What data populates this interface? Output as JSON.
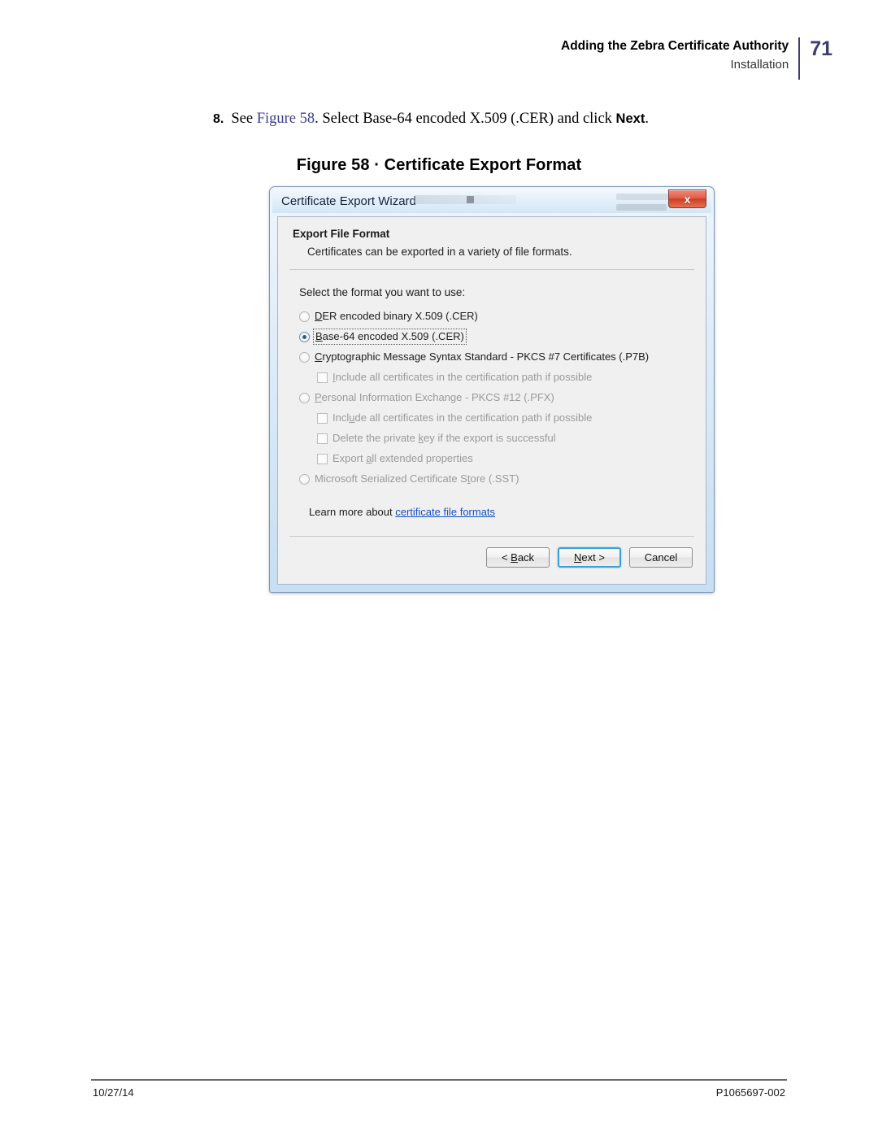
{
  "header": {
    "title": "Adding the Zebra Certificate Authority",
    "subtitle": "Installation",
    "page_number": "71",
    "accent_color": "#3b3f6b"
  },
  "step": {
    "number": "8.",
    "text_before": "See ",
    "xref": "Figure 58",
    "text_middle": ". Select Base-64 encoded X.509 (.CER) and click ",
    "emphasis": "Next",
    "text_after": "."
  },
  "figure": {
    "caption": "Figure 58 · Certificate Export Format"
  },
  "dialog": {
    "title": "Certificate Export Wizard",
    "close_label": "x",
    "heading": "Export File Format",
    "description": "Certificates can be exported in a variety of file formats.",
    "prompt": "Select the format you want to use:",
    "options": [
      {
        "id": "der",
        "type": "radio",
        "checked": false,
        "disabled": false,
        "focused": false,
        "indent": false,
        "accel": "D",
        "label_rest": "ER encoded binary X.509 (.CER)"
      },
      {
        "id": "base64",
        "type": "radio",
        "checked": true,
        "disabled": false,
        "focused": true,
        "indent": false,
        "accel": "B",
        "label_rest": "ase-64 encoded X.509 (.CER)"
      },
      {
        "id": "pkcs7",
        "type": "radio",
        "checked": false,
        "disabled": false,
        "focused": false,
        "indent": false,
        "accel": "C",
        "label_rest": "ryptographic Message Syntax Standard - PKCS #7 Certificates (.P7B)"
      },
      {
        "id": "pkcs7-include-all",
        "type": "checkbox",
        "checked": false,
        "disabled": true,
        "focused": false,
        "indent": true,
        "accel": "I",
        "label_rest": "nclude all certificates in the certification path if possible"
      },
      {
        "id": "pfx",
        "type": "radio",
        "checked": false,
        "disabled": true,
        "focused": false,
        "indent": false,
        "accel": "P",
        "label_rest": "ersonal Information Exchange - PKCS #12 (.PFX)"
      },
      {
        "id": "pfx-include-all",
        "type": "checkbox",
        "checked": false,
        "disabled": true,
        "focused": false,
        "indent": true,
        "accel": "u",
        "label_rest": "de all certificates in the certification path if possible",
        "label_pre": "Incl"
      },
      {
        "id": "delete-private-key",
        "type": "checkbox",
        "checked": false,
        "disabled": true,
        "focused": false,
        "indent": true,
        "accel": "k",
        "label_pre": "Delete the private ",
        "label_rest": "ey if the export is successful"
      },
      {
        "id": "export-extended-props",
        "type": "checkbox",
        "checked": false,
        "disabled": true,
        "focused": false,
        "indent": true,
        "accel": "a",
        "label_pre": "Export ",
        "label_rest": "ll extended properties"
      },
      {
        "id": "sst",
        "type": "radio",
        "checked": false,
        "disabled": true,
        "focused": false,
        "indent": false,
        "accel": "t",
        "label_pre": "Microsoft Serialized Certificate S",
        "label_rest": "ore (.SST)"
      }
    ],
    "learn_more_prefix": "Learn more about ",
    "learn_more_link": "certificate file formats",
    "buttons": {
      "back": {
        "pre": "< ",
        "accel": "B",
        "rest": "ack"
      },
      "next": {
        "pre": "",
        "accel": "N",
        "rest": "ext >"
      },
      "cancel": {
        "pre": "",
        "accel": "",
        "rest": "Cancel"
      }
    }
  },
  "footer": {
    "left": "10/27/14",
    "right": "P1065697-002"
  }
}
